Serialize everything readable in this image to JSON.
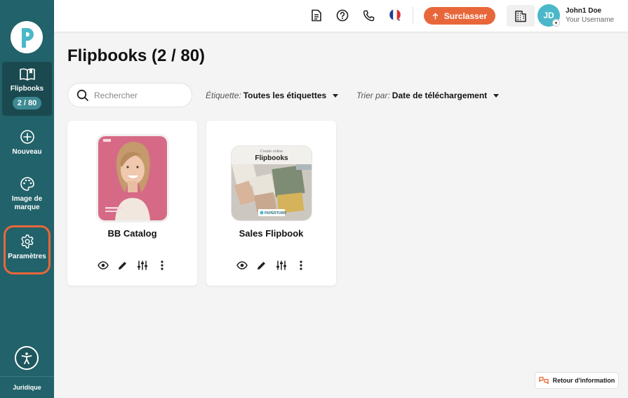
{
  "sidebar": {
    "items": [
      {
        "label": "Flipbooks",
        "badge": "2 / 80"
      },
      {
        "label": "Nouveau"
      },
      {
        "label": "Image de marque"
      },
      {
        "label": "Paramètres"
      }
    ],
    "footer": "Juridique"
  },
  "header": {
    "upgrade_label": "Surclasser",
    "user": {
      "initials": "JD",
      "name": "John1 Doe",
      "username": "Your Username"
    }
  },
  "main": {
    "title": "Flipbooks (2 / 80)",
    "search": {
      "placeholder": "Rechercher",
      "value": ""
    },
    "filters": {
      "label_filter": {
        "label": "Étiquette:",
        "value": "Toutes les étiquettes"
      },
      "sort": {
        "label": "Trier par:",
        "value": "Date de téléchargement"
      }
    },
    "cards": [
      {
        "title": "BB Catalog"
      },
      {
        "title": "Sales Flipbook",
        "thumb_text": {
          "top": "Create online",
          "main": "Flipbooks",
          "brand": "PAPERTURN"
        }
      }
    ]
  },
  "feedback_label": "Retour d'information",
  "colors": {
    "sidebar": "#22626a",
    "accent": "#e8673a",
    "avatar": "#4ab8c8"
  },
  "icons": [
    "document-icon",
    "help-icon",
    "phone-icon",
    "flag-fr-icon",
    "building-icon",
    "search-icon",
    "eye-icon",
    "pencil-icon",
    "sliders-icon",
    "more-vertical-icon",
    "book-open-icon",
    "plus-circle-icon",
    "palette-icon",
    "gear-icon",
    "accessibility-icon"
  ]
}
